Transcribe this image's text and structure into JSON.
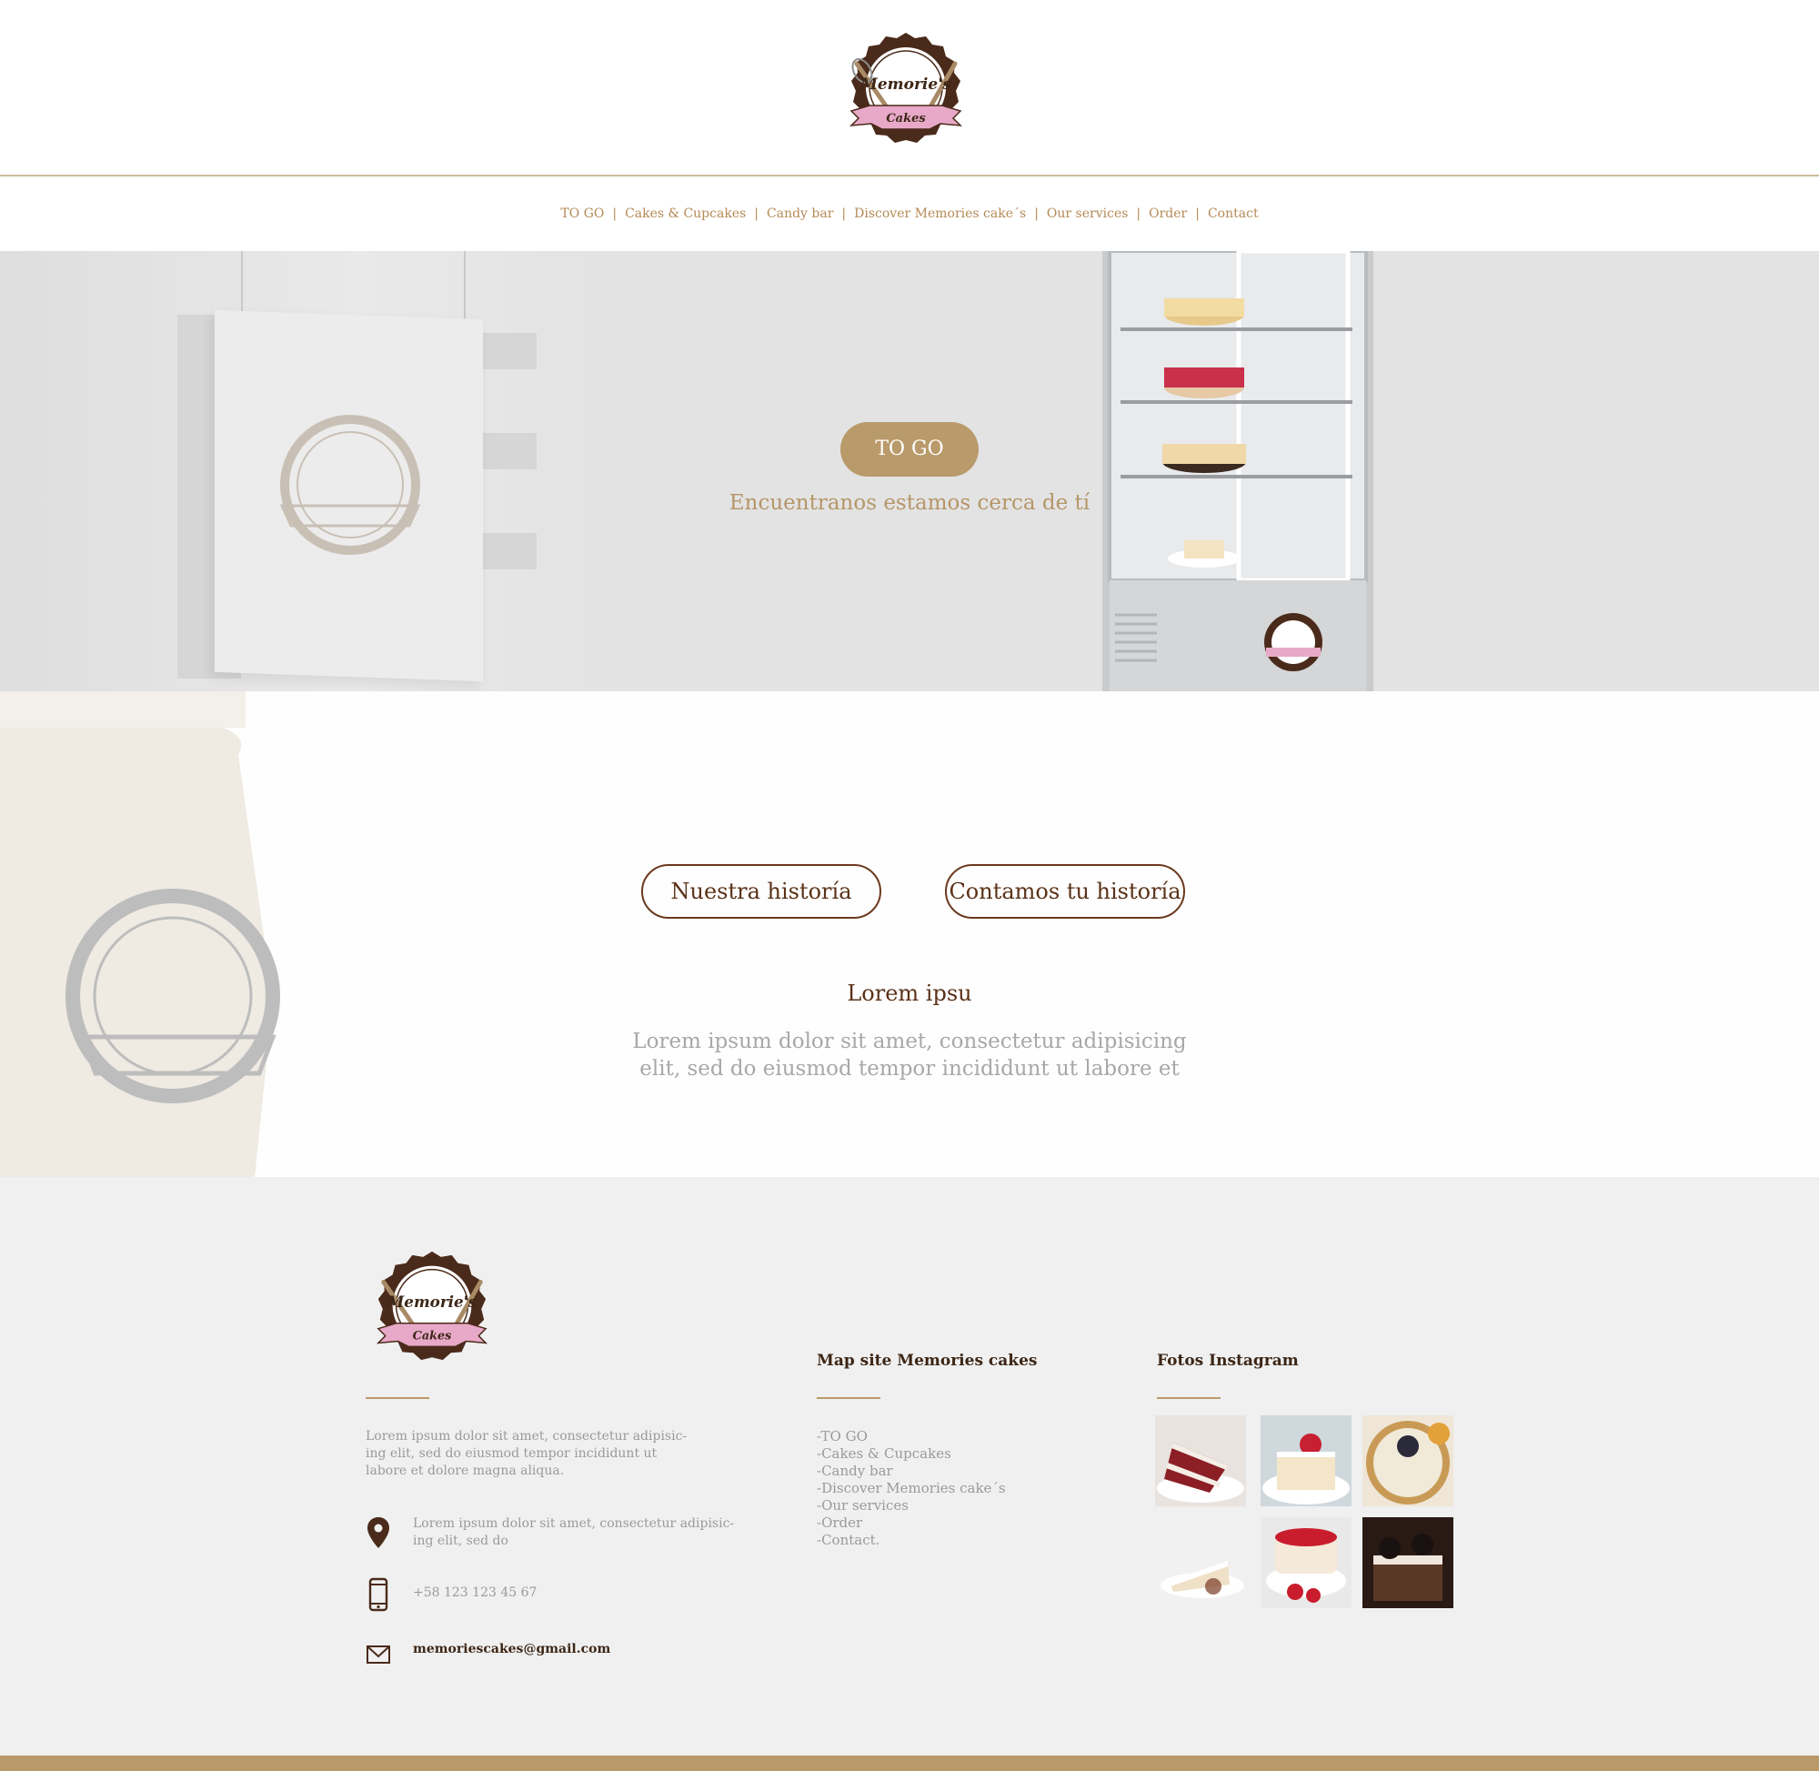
{
  "brand": {
    "logo_top_line": "Memorie's",
    "logo_bottom_line": "Cakes",
    "accent_color": "#b99a6a",
    "brown_color": "#5b3218"
  },
  "nav": {
    "items": [
      {
        "label": "TO GO"
      },
      {
        "label": "Cakes & Cupcakes"
      },
      {
        "label": "Candy bar"
      },
      {
        "label": "Discover Memories cake´s"
      },
      {
        "label": "Our services"
      },
      {
        "label": "Order"
      },
      {
        "label": "Contact"
      }
    ],
    "separator": "|"
  },
  "hero": {
    "button_label": "TO GO",
    "subtitle": "Encuentranos estamos cerca de tí"
  },
  "story": {
    "button_left": "Nuestra historía",
    "button_right": "Contamos tu historía",
    "title": "Lorem ipsu",
    "text": "Lorem ipsum dolor sit amet, consectetur adipisicing elit, sed do eiusmod tempor incididunt ut labore et"
  },
  "footer": {
    "about_text": "Lorem ipsum dolor sit amet, consectetur adipisic-ing elit, sed do eiusmod tempor incididunt ut labore et dolore magna aliqua.",
    "address": "Lorem ipsum dolor sit amet, consectetur adipisic-ing elit, sed do",
    "phone": "+58 123 123 45 67",
    "email": "memoriescakes@gmail.com",
    "map_heading": "Map site Memories cakes",
    "map_items": [
      "-TO GO",
      "-Cakes & Cupcakes",
      "-Candy bar",
      "-Discover Memories cake´s",
      "-Our services",
      "-Order",
      "-Contact."
    ],
    "insta_heading": "Fotos Instagram",
    "insta_photos": [
      "red-velvet-cake",
      "tres-leches-strawberry",
      "blueberry-tart",
      "white-cake-slice",
      "strawberry-shortcake",
      "chocolate-oreo-cake"
    ]
  }
}
